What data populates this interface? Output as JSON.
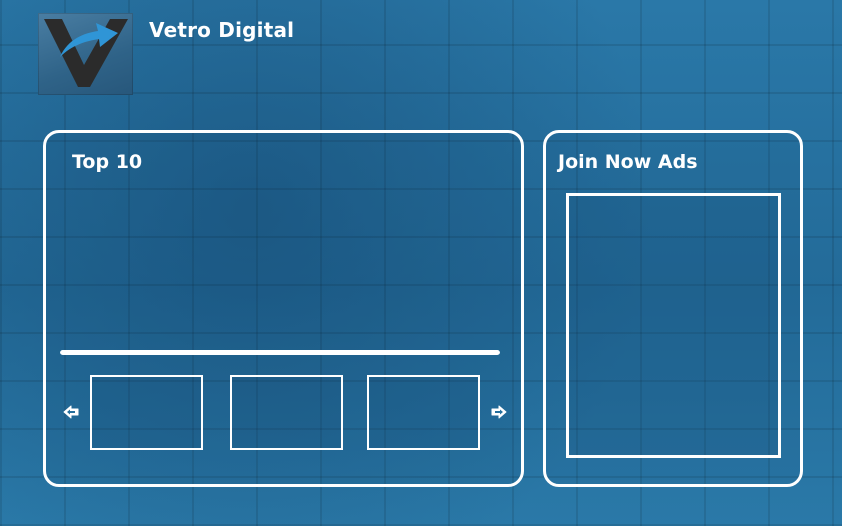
{
  "brand": {
    "name": "Vetro Digital",
    "logo_icon": "vetro-v-logo-icon",
    "colors": {
      "background": "#256f9d",
      "logo_dark": "#2b2b2b",
      "logo_accent": "#2f95d6",
      "outline": "#ffffff"
    }
  },
  "top10": {
    "title": "Top 10",
    "progress": 1.0,
    "prev_icon": "arrow-left-icon",
    "next_icon": "arrow-right-icon",
    "thumbnails": [
      "",
      "",
      ""
    ]
  },
  "ads": {
    "title": "Join Now Ads"
  }
}
